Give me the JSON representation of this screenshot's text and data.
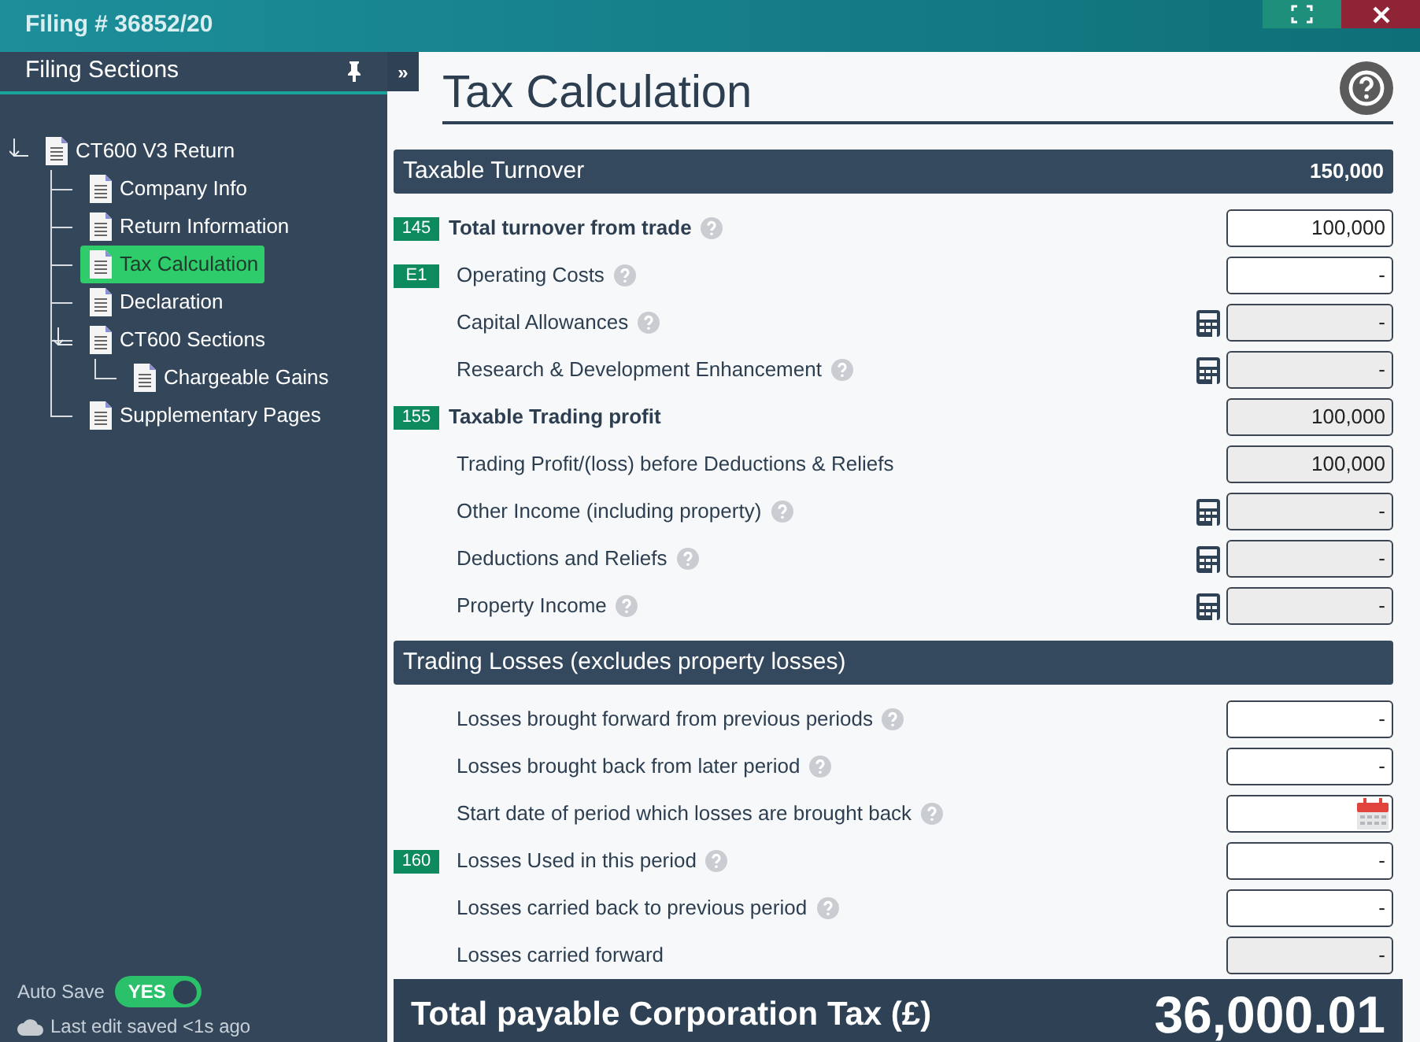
{
  "window": {
    "title": "Filing # 36852/20"
  },
  "sidebar": {
    "title": "Filing Sections",
    "tree": [
      {
        "label": "CT600 V3 Return",
        "selected": false,
        "expanded": true,
        "children": [
          {
            "label": "Company Info",
            "selected": false
          },
          {
            "label": "Return Information",
            "selected": false
          },
          {
            "label": "Tax Calculation",
            "selected": true
          },
          {
            "label": "Declaration",
            "selected": false
          },
          {
            "label": "CT600 Sections",
            "selected": false,
            "expanded": true,
            "children": [
              {
                "label": "Chargeable Gains",
                "selected": false
              }
            ]
          },
          {
            "label": "Supplementary Pages",
            "selected": false
          }
        ]
      }
    ],
    "auto_save": {
      "label": "Auto Save",
      "on": true,
      "toggle_text": "YES"
    },
    "save_status": "Last edit saved <1s ago"
  },
  "page": {
    "title": "Tax Calculation",
    "expand_button": "»",
    "sections": [
      {
        "title": "Taxable Turnover",
        "total": "150,000",
        "rows": [
          {
            "code": "145",
            "label": "Total turnover from trade",
            "bold": true,
            "help": true,
            "kind": "editable",
            "value": "100,000"
          },
          {
            "code": "E1",
            "label": "Operating Costs",
            "bold": false,
            "help": true,
            "kind": "editable",
            "value": "-"
          },
          {
            "label": "Capital Allowances",
            "bold": false,
            "help": true,
            "calculator": true,
            "kind": "readonly",
            "value": "-"
          },
          {
            "label": "Research & Development Enhancement",
            "bold": false,
            "help": true,
            "calculator": true,
            "kind": "readonly",
            "value": "-"
          },
          {
            "code": "155",
            "label": "Taxable Trading profit",
            "bold": true,
            "kind": "readonly",
            "value": "100,000"
          },
          {
            "label": "Trading Profit/(loss) before Deductions & Reliefs",
            "bold": false,
            "kind": "readonly",
            "value": "100,000"
          },
          {
            "label": "Other Income (including property)",
            "bold": false,
            "help": true,
            "calculator": true,
            "kind": "readonly",
            "value": "-"
          },
          {
            "label": "Deductions and Reliefs",
            "bold": false,
            "help": true,
            "calculator": true,
            "kind": "readonly",
            "value": "-"
          },
          {
            "label": "Property Income",
            "bold": false,
            "help": true,
            "calculator": true,
            "kind": "readonly",
            "value": "-"
          }
        ]
      },
      {
        "title": "Trading Losses (excludes property losses)",
        "rows": [
          {
            "label": "Losses brought forward from previous periods",
            "bold": false,
            "help": true,
            "kind": "editable",
            "value": "-"
          },
          {
            "label": "Losses brought back from later period",
            "bold": false,
            "help": true,
            "kind": "editable",
            "value": "-"
          },
          {
            "label": "Start date of period which losses are brought back",
            "bold": false,
            "help": true,
            "kind": "date"
          },
          {
            "code": "160",
            "label": "Losses Used in this period",
            "bold": false,
            "help": true,
            "kind": "editable",
            "value": "-"
          },
          {
            "label": "Losses carried back to previous period",
            "bold": false,
            "help": true,
            "kind": "editable",
            "value": "-"
          },
          {
            "label": "Losses carried forward",
            "bold": false,
            "kind": "readonly",
            "value": "-"
          }
        ]
      }
    ],
    "total": {
      "label": "Total payable Corporation Tax (£)",
      "value": "36,000.01"
    }
  }
}
